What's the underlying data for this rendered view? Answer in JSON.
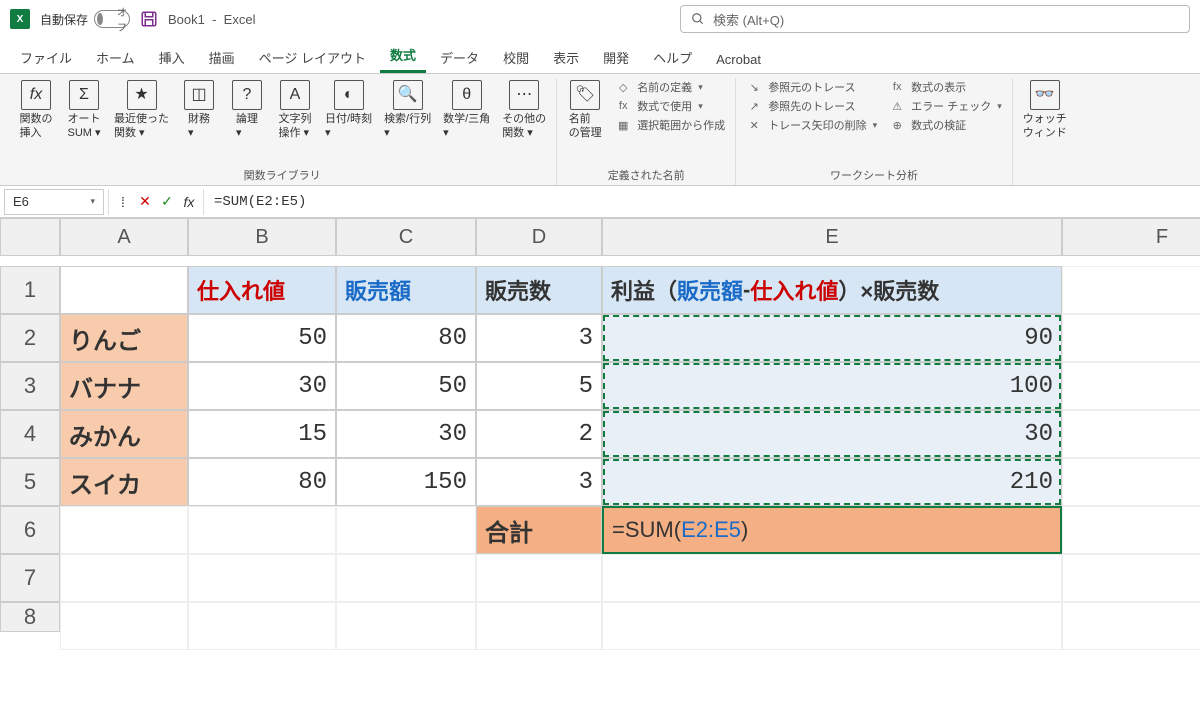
{
  "title": {
    "autosave_label": "自動保存",
    "autosave_state": "オフ",
    "document": "Book1",
    "app": "Excel",
    "search_placeholder": "検索 (Alt+Q)"
  },
  "tabs": {
    "file": "ファイル",
    "home": "ホーム",
    "insert": "挿入",
    "draw": "描画",
    "layout": "ページ レイアウト",
    "formulas": "数式",
    "data": "データ",
    "review": "校閲",
    "view": "表示",
    "dev": "開発",
    "help": "ヘルプ",
    "acrobat": "Acrobat"
  },
  "ribbon": {
    "insert_fn": "関数の\n挿入",
    "autosum": "オート\nSUM ▾",
    "recent": "最近使った\n関数 ▾",
    "financial": "財務\n▾",
    "logical": "論理\n▾",
    "text": "文字列\n操作 ▾",
    "datetime": "日付/時刻\n▾",
    "lookup": "検索/行列\n▾",
    "math": "数学/三角\n▾",
    "other": "その他の\n関数 ▾",
    "lib_label": "関数ライブラリ",
    "name_mgr": "名前\nの管理",
    "define": "名前の定義",
    "use": "数式で使用",
    "from_sel": "選択範囲から作成",
    "names_label": "定義された名前",
    "trace_prec": "参照元のトレース",
    "trace_dep": "参照先のトレース",
    "remove_arrows": "トレース矢印の削除",
    "show_formulas": "数式の表示",
    "error_check": "エラー チェック",
    "eval": "数式の検証",
    "analysis_label": "ワークシート分析",
    "watch": "ウォッチ\nウィンド"
  },
  "formula_bar": {
    "cell": "E6",
    "formula": "=SUM(E2:E5)"
  },
  "cols": {
    "A": "A",
    "B": "B",
    "C": "C",
    "D": "D",
    "E": "E",
    "F": "F"
  },
  "rows": [
    "1",
    "2",
    "3",
    "4",
    "5",
    "6",
    "7",
    "8"
  ],
  "headers": {
    "b": "仕入れ値",
    "c": "販売額",
    "d": "販売数",
    "e_pre": "利益（",
    "e_sales": "販売額",
    "e_minus": "-",
    "e_cost": "仕入れ値",
    "e_post": "）×販売数"
  },
  "items": [
    {
      "name": "りんご",
      "cost": "50",
      "sales": "80",
      "qty": "3",
      "profit": "90"
    },
    {
      "name": "バナナ",
      "cost": "30",
      "sales": "50",
      "qty": "5",
      "profit": "100"
    },
    {
      "name": "みかん",
      "cost": "15",
      "sales": "30",
      "qty": "2",
      "profit": "30"
    },
    {
      "name": "スイカ",
      "cost": "80",
      "sales": "150",
      "qty": "3",
      "profit": "210"
    }
  ],
  "total_label": "合計",
  "active_formula": {
    "pre": "=SUM(",
    "range": "E2:E5",
    "post": ")"
  }
}
